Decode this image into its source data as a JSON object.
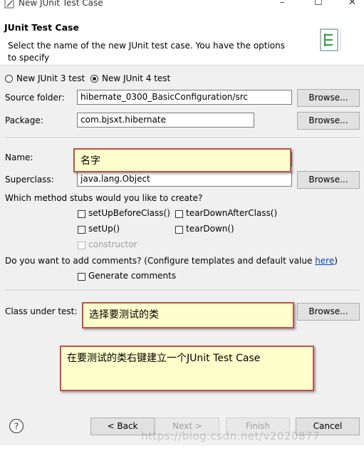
{
  "window": {
    "title": "New JUnit Test Case",
    "controls": [
      "–",
      "☐",
      "✕"
    ]
  },
  "header": {
    "title": "JUnit Test Case",
    "description": "Select the name of the new JUnit test case. You have the options to specify"
  },
  "version": {
    "junit3": "New JUnit 3 test",
    "junit4": "New JUnit 4 test",
    "selected": "junit4"
  },
  "source_folder": {
    "label": "Source folder:",
    "value": "hibernate_0300_BasicConfiguration/src",
    "browse": "Browse..."
  },
  "package": {
    "label": "Package:",
    "value": "com.bjsxt.hibernate",
    "browse": "Browse..."
  },
  "name": {
    "label": "Name:",
    "value": ""
  },
  "superclass": {
    "label": "Superclass:",
    "value": "java.lang.Object",
    "browse": "Browse..."
  },
  "stubs": {
    "question": "Which method stubs would you like to create?",
    "setUpBeforeClass": "setUpBeforeClass()",
    "tearDownAfterClass": "tearDownAfterClass()",
    "setUp": "setUp()",
    "tearDown": "tearDown()",
    "constructor": "constructor"
  },
  "comments": {
    "question_pre": "Do you want to add comments? (Configure templates and default value ",
    "link": "here",
    "question_post": ")",
    "generate": "Generate comments"
  },
  "class_under_test": {
    "label": "Class under test:",
    "browse": "Browse..."
  },
  "annotations": {
    "name_note": "名字",
    "class_note": "选择要测试的类",
    "rightclick_note": "在要测试的类右键建立一个JUnit Test Case"
  },
  "footer": {
    "back": "< Back",
    "next": "Next >",
    "finish": "Finish",
    "cancel": "Cancel",
    "watermark": "https://blog.csdn.net/v2020877"
  }
}
